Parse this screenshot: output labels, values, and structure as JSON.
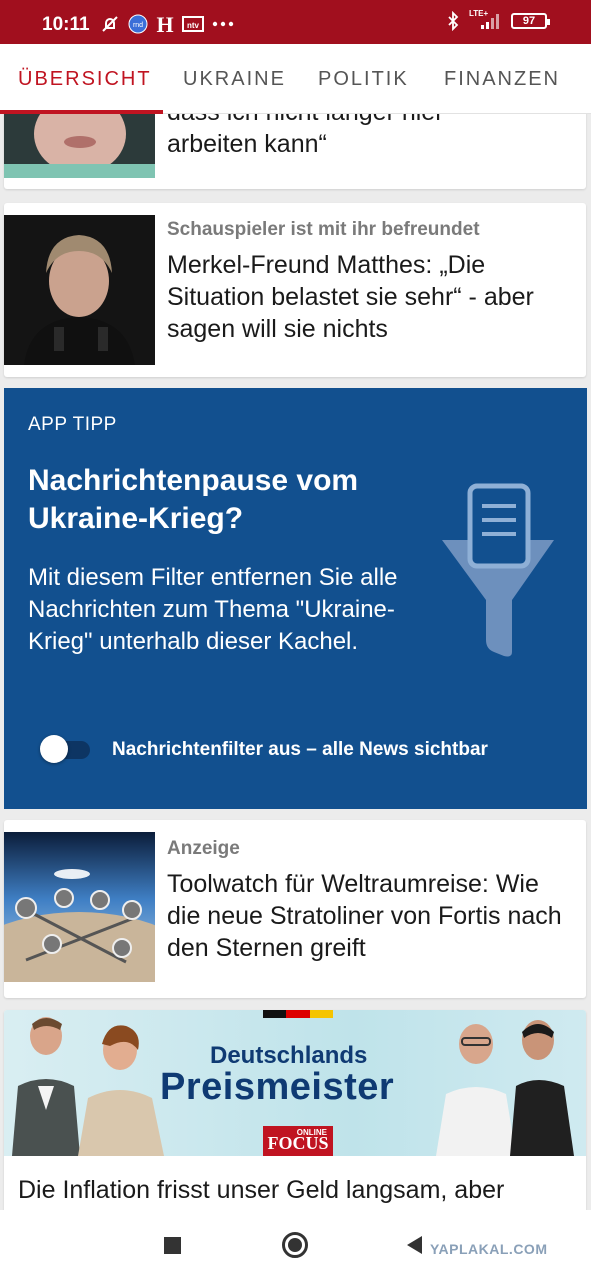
{
  "status_bar": {
    "time": "10:11",
    "battery": "97",
    "network": "LTE+",
    "icons": [
      "dnd-off-icon",
      "rnd-app-icon",
      "h-app-icon",
      "ntv-app-icon",
      "more-dots-icon",
      "bluetooth-icon",
      "signal-icon",
      "battery-icon"
    ]
  },
  "tabs": [
    {
      "label": "ÜBERSICHT",
      "active": true
    },
    {
      "label": "UKRAINE",
      "active": false
    },
    {
      "label": "POLITIK",
      "active": false
    },
    {
      "label": "FINANZEN",
      "active": false
    }
  ],
  "articles": {
    "top_partial": {
      "headline_line1": "dass ich nicht länger hier",
      "headline_line2": "arbeiten kann“"
    },
    "merkel": {
      "kicker": "Schauspieler ist mit ihr befreundet",
      "headline": "Merkel-Freund Matthes: „Die Situation belastet sie sehr“ - aber sagen will sie nichts"
    },
    "ad": {
      "kicker": "Anzeige",
      "headline": "Toolwatch für Weltraumreise: Wie die neue Stratoliner von Fortis nach den Sternen greift"
    },
    "preismeister": {
      "banner_line1": "Deutschlands",
      "banner_line2": "Preismeister",
      "logo_top": "ONLINE",
      "logo": "FOCUS",
      "headline": "Die Inflation frisst unser Geld langsam, aber"
    }
  },
  "app_tip": {
    "label": "APP TIPP",
    "title": "Nachrichtenpause vom Ukraine-Krieg?",
    "body": "Mit diesem Filter entfernen Sie alle Nachrichten zum Thema \"Ukraine-Krieg\" unterhalb dieser Kachel.",
    "toggle_label": "Nachrichtenfilter aus – alle News sichtbar",
    "toggle_on": false
  },
  "colors": {
    "status_bar": "#a10f1e",
    "accent": "#c01421",
    "tip_background": "#12508f"
  },
  "watermark": "YAPLAKAL.COM"
}
